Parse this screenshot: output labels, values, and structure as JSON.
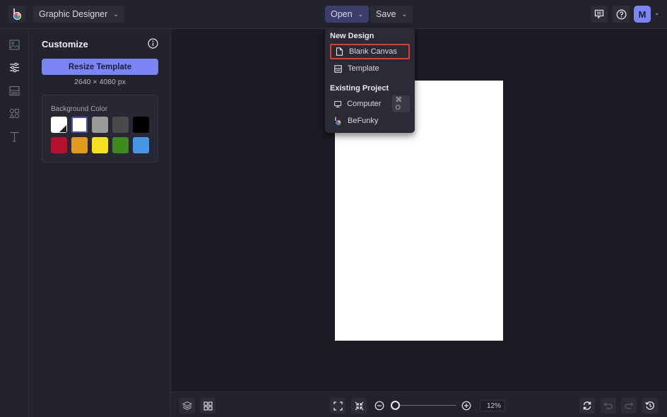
{
  "topbar": {
    "app_logo": "befunky-logo",
    "mode_label": "Graphic Designer",
    "open_label": "Open",
    "save_label": "Save",
    "avatar_initial": "M",
    "icons": [
      "comment-icon",
      "help-icon",
      "chevron-down-icon"
    ]
  },
  "rail": {
    "items": [
      {
        "name": "image-manager",
        "icon": "image-icon",
        "active": false
      },
      {
        "name": "customize",
        "icon": "sliders-icon",
        "active": true
      },
      {
        "name": "layouts",
        "icon": "layout-icon",
        "active": false
      },
      {
        "name": "graphics",
        "icon": "shapes-icon",
        "active": false
      },
      {
        "name": "text",
        "icon": "text-icon",
        "active": false
      }
    ]
  },
  "panel": {
    "title": "Customize",
    "resize_label": "Resize Template",
    "dimensions": "2640 × 4080 px",
    "background": {
      "label": "Background Color",
      "swatches": [
        {
          "name": "custom",
          "color": "#ffffff"
        },
        {
          "name": "white",
          "color": "#ffffff",
          "selected": true
        },
        {
          "name": "gray",
          "color": "#9a9a9a"
        },
        {
          "name": "dark-gray",
          "color": "#4a4a4a"
        },
        {
          "name": "black",
          "color": "#000000"
        },
        {
          "name": "red",
          "color": "#b5102f"
        },
        {
          "name": "orange",
          "color": "#e29a1a"
        },
        {
          "name": "yellow",
          "color": "#f6df1c"
        },
        {
          "name": "green",
          "color": "#3f8a1e"
        },
        {
          "name": "blue",
          "color": "#4a96e6"
        }
      ]
    }
  },
  "open_menu": {
    "new_design_header": "New Design",
    "blank_canvas": "Blank Canvas",
    "template": "Template",
    "existing_header": "Existing Project",
    "computer": "Computer",
    "computer_shortcut": "⌘ O",
    "befunky": "BeFunky"
  },
  "bottombar": {
    "zoom_value": "12%",
    "zoom_fraction": 0.0
  },
  "colors": {
    "accent": "#7b85f3",
    "highlight": "#e53d2b"
  }
}
